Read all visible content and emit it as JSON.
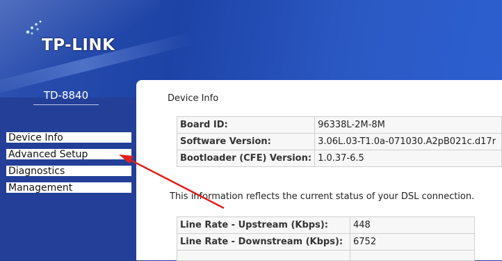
{
  "brand": {
    "logo": "TP-LINK",
    "model": "TD-8840"
  },
  "sidebar": {
    "items": [
      {
        "label": "Device Info"
      },
      {
        "label": "Advanced Setup"
      },
      {
        "label": "Diagnostics"
      },
      {
        "label": "Management"
      }
    ]
  },
  "content": {
    "title": "Device Info",
    "device_table": [
      {
        "label": "Board ID:",
        "value": "96338L-2M-8M"
      },
      {
        "label": "Software Version:",
        "value": "3.06L.03-T1.0a-071030.A2pB021c.d17r"
      },
      {
        "label": "Bootloader (CFE) Version:",
        "value": "1.0.37-6.5"
      }
    ],
    "status_note": "This information reflects the current status of your DSL connection.",
    "dsl_table": [
      {
        "label": "Line Rate - Upstream (Kbps):",
        "value": "448"
      },
      {
        "label": "Line Rate - Downstream (Kbps):",
        "value": "6752"
      }
    ]
  },
  "colors": {
    "header": "#2b4fb0",
    "sidebar": "#233f98",
    "annotation_arrow": "#e0201b"
  },
  "icons": {
    "logo_mark": "tp-link-signal-icon"
  }
}
